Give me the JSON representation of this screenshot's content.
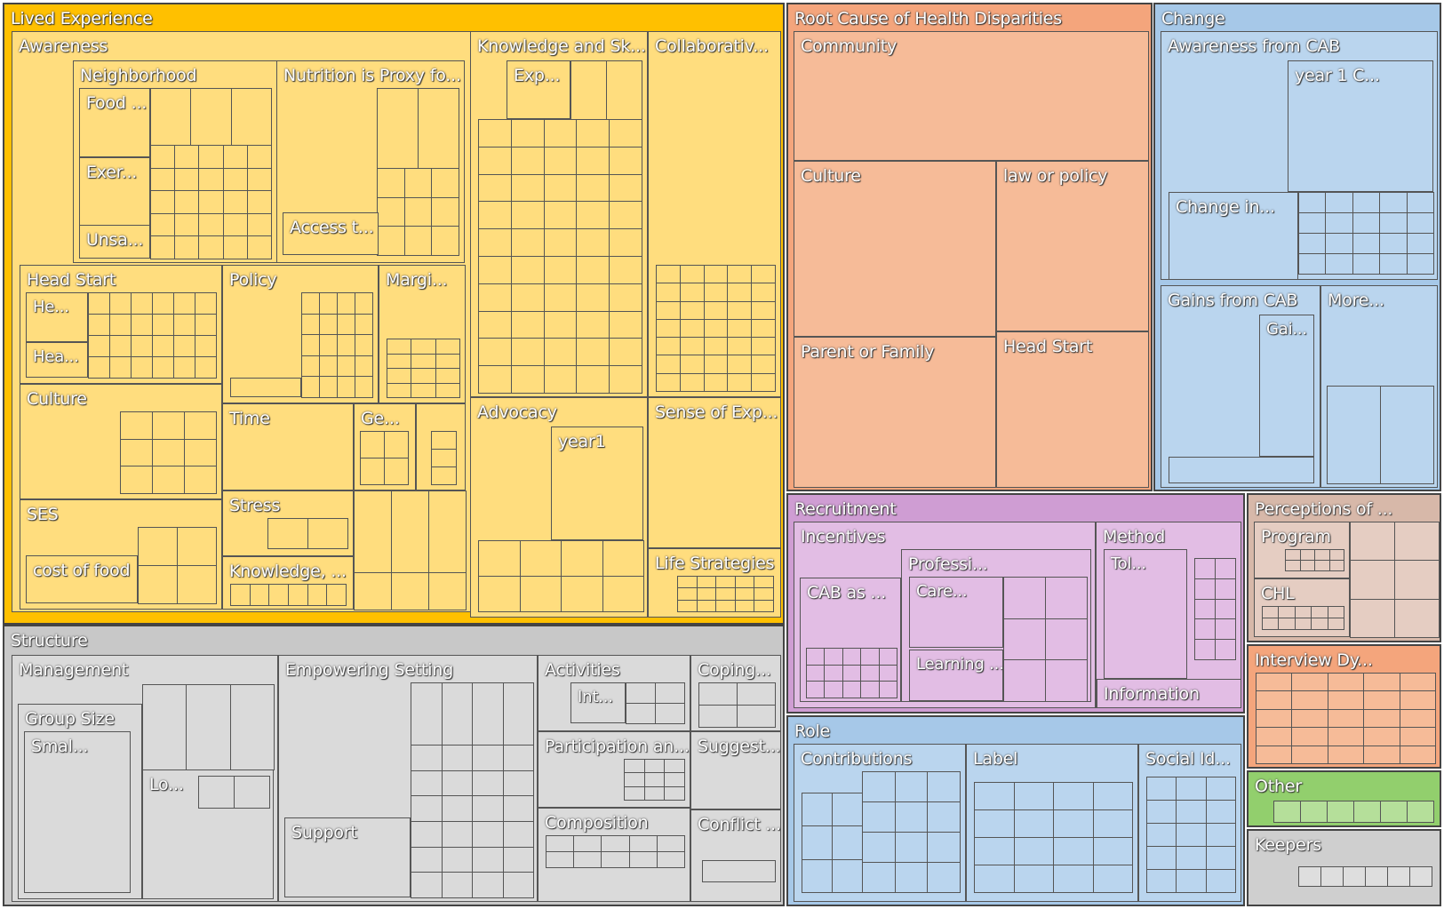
{
  "chart_data": {
    "type": "treemap",
    "title": "",
    "groups": [
      {
        "name": "Lived Experience",
        "color": "#ffc000",
        "child_color": "#ffdd7e",
        "children": [
          "Awareness",
          "Neighborhood",
          "Food ...",
          "Exer...",
          "Unsa...",
          "Nutrition is Proxy fo...",
          "Access t...",
          "Head Start",
          "He...",
          "Hea...",
          "Policy",
          "Margi...",
          "Culture",
          "Time",
          "Ge...",
          "Stress",
          "SES",
          "cost of food",
          "Knowledge, ...",
          "Knowledge and Sk...",
          "Exp...",
          "Collaborativ...",
          "Advocacy",
          "year1",
          "Sense of Exp...",
          "Life Strategies"
        ]
      },
      {
        "name": "Root Cause of Health Disparities",
        "color": "#f4a57c",
        "child_color": "#f6bb98",
        "children": [
          "Community",
          "Culture",
          "law or policy",
          "Parent or Family",
          "Head Start"
        ]
      },
      {
        "name": "Change",
        "color": "#a6c8e8",
        "child_color": "#bad5ee",
        "children": [
          "Awareness from CAB",
          "year 1 C...",
          "Change in...",
          "Gains from CAB",
          "Gai...",
          "More..."
        ]
      },
      {
        "name": "Structure",
        "color": "#c8c8c8",
        "child_color": "#dadada",
        "children": [
          "Management",
          "Group Size",
          "Smal...",
          "Lo...",
          "Empowering Setting",
          "Support",
          "Activities",
          "Int...",
          "Participation an...",
          "Composition",
          "Coping...",
          "Suggest...",
          "Conflict ..."
        ]
      },
      {
        "name": "Recruitment",
        "color": "#cf9dd3",
        "child_color": "#e2bde4",
        "children": [
          "Incentives",
          "CAB as ...",
          "Professi...",
          "Care...",
          "Learning ...",
          "Method",
          "Tol...",
          "Information"
        ]
      },
      {
        "name": "Perceptions of ...",
        "color": "#d7b8a9",
        "child_color": "#e5cdc2",
        "children": [
          "Program",
          "CHL"
        ]
      },
      {
        "name": "Role",
        "color": "#a6c8e8",
        "child_color": "#bad5ee",
        "children": [
          "Contributions",
          "Label",
          "Social Id..."
        ]
      },
      {
        "name": "Interview Dy...",
        "color": "#f4a57c",
        "child_color": "#f6bb98",
        "children": []
      },
      {
        "name": "Other",
        "color": "#92cf6d",
        "child_color": "#b5df9a",
        "children": []
      },
      {
        "name": "Keepers",
        "color": "#cfcfcf",
        "child_color": "#dedede",
        "children": []
      }
    ]
  }
}
